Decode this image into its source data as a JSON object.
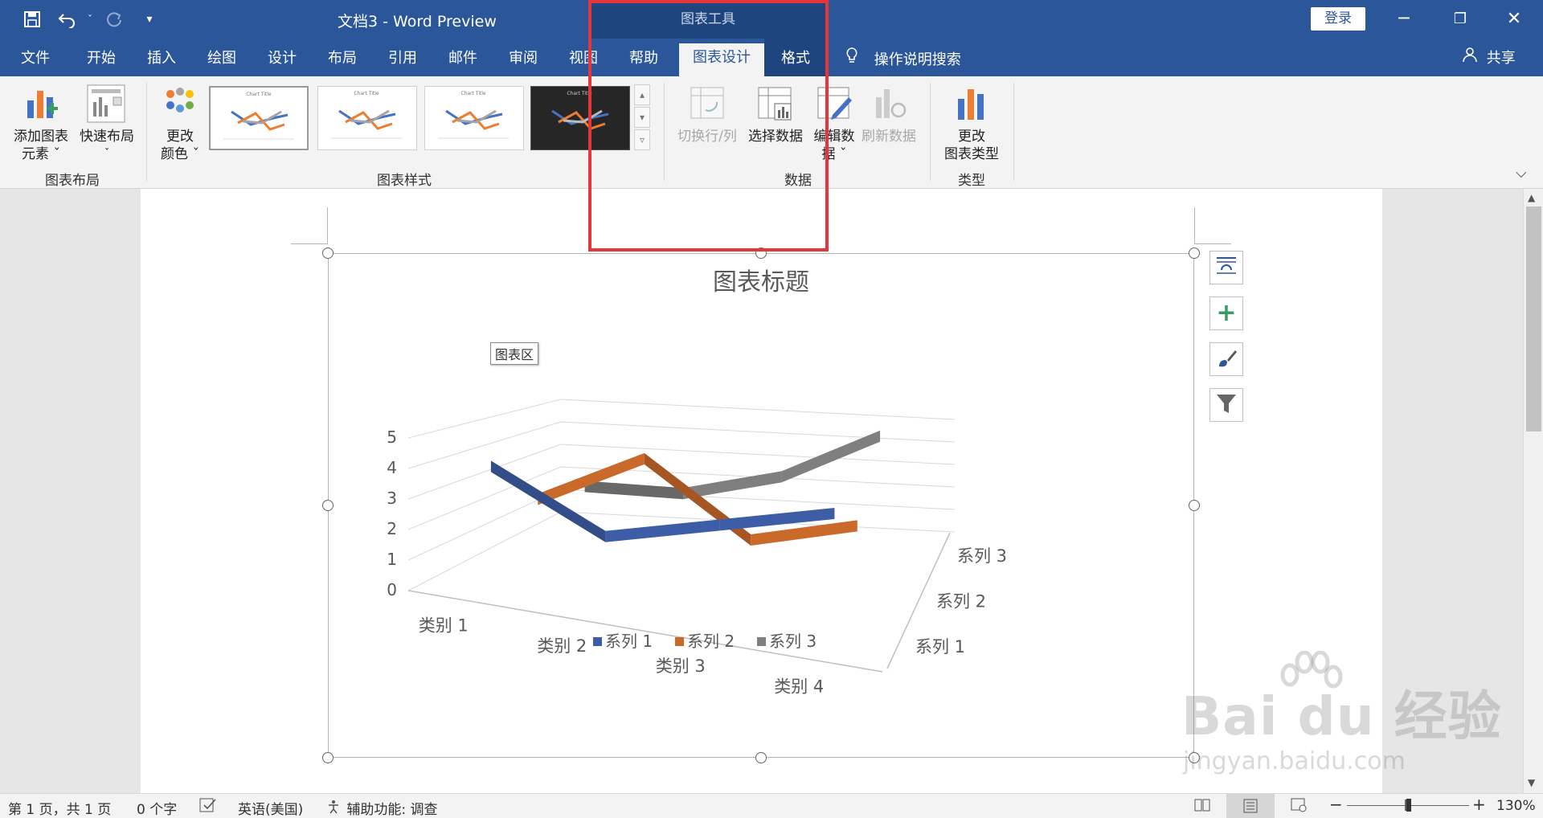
{
  "titlebar": {
    "title": "文档3  -  Word Preview",
    "context_tab": "图表工具",
    "login_label": "登录",
    "icons": [
      "save-icon",
      "undo-icon",
      "redo-icon",
      "customize-quick-access-icon"
    ]
  },
  "tabs": [
    "文件",
    "开始",
    "插入",
    "绘图",
    "设计",
    "布局",
    "引用",
    "邮件",
    "审阅",
    "视图",
    "帮助",
    "图表设计",
    "格式"
  ],
  "active_tab": "图表设计",
  "search_label": "操作说明搜索",
  "share_label": "共享",
  "ribbon": {
    "add_element": [
      "添加图表",
      "元素 ˇ"
    ],
    "quick_layout": [
      "快速布局",
      "ˇ"
    ],
    "group_layout": "图表布局",
    "change_colors": [
      "更改",
      "颜色 ˇ"
    ],
    "group_styles": "图表样式",
    "switch_row_col": "切换行/列",
    "select_data": "选择数据",
    "edit_data": [
      "编辑数",
      "据 ˇ"
    ],
    "refresh_data": "刷新数据",
    "group_data": "数据",
    "change_type": [
      "更改",
      "图表类型"
    ],
    "group_type": "类型"
  },
  "chart": {
    "title": "图表标题",
    "area_tooltip": "图表区",
    "chart_data": {
      "type": "line",
      "title": "图表标题",
      "categories": [
        "类别 1",
        "类别 2",
        "类别 3",
        "类别 4"
      ],
      "y_ticks": [
        "0",
        "1",
        "2",
        "3",
        "4",
        "5"
      ],
      "ylim": [
        0,
        5
      ],
      "depth_labels": [
        "系列 1",
        "系列 2",
        "系列 3"
      ],
      "series": [
        {
          "name": "系列 1",
          "color": "#3d5ea6",
          "values": [
            4.3,
            2.5,
            3.5,
            4.5
          ]
        },
        {
          "name": "系列 2",
          "color": "#c9692a",
          "values": [
            2.4,
            4.4,
            1.8,
            2.8
          ]
        },
        {
          "name": "系列 3",
          "color": "#7f7f7f",
          "values": [
            2.0,
            2.0,
            3.0,
            5.0
          ]
        }
      ],
      "legend_position": "bottom",
      "grid": true,
      "style": "3D line"
    }
  },
  "statusbar": {
    "page": "第 1 页，共 1 页",
    "words": "0 个字",
    "language": "英语(美国)",
    "accessibility": "辅助功能: 调查",
    "zoom": "130%"
  },
  "watermark": {
    "main": "Bai du 经验",
    "sub": "jingyan.baidu.com"
  }
}
